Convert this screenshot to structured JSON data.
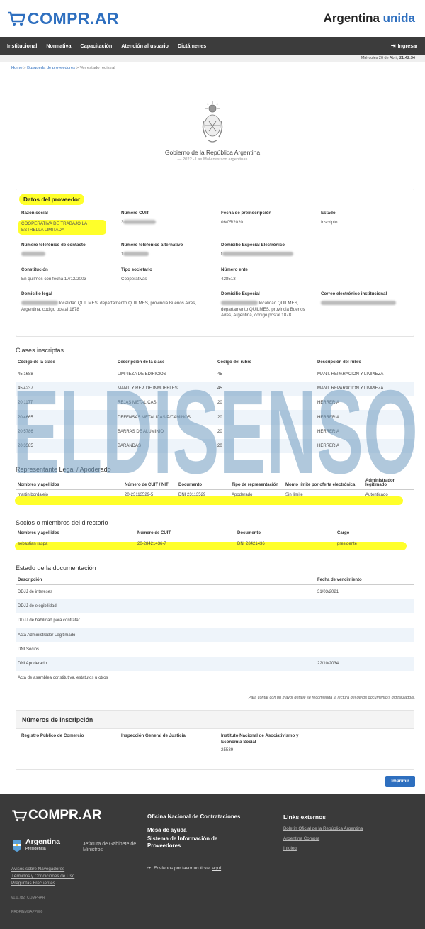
{
  "header": {
    "logo_text": "COMPR.AR",
    "brand_right_1": "Argentina",
    "brand_right_2": "unida"
  },
  "nav": {
    "items": [
      "Institucional",
      "Normativa",
      "Capacitación",
      "Atención al usuario",
      "Dictámenes"
    ],
    "login": "Ingresar"
  },
  "datebar": {
    "date": "Miércoles 20 de Abril,",
    "time": "21:42:34"
  },
  "breadcrumb": {
    "home": "Home",
    "search": "Busqueda de proveedores",
    "current": "Ver estado registral"
  },
  "gov": {
    "title": "Gobierno de la República Argentina",
    "subtitle": "— 2022 - Las Malvinas son argentinas"
  },
  "proveedor": {
    "title": "Datos del proveedor",
    "razon_label": "Razón social",
    "razon_value": "COOPERATIVA DE TRABAJO LA ESTRELLA LIMITADA",
    "cuit_label": "Número CUIT",
    "cuit_prefix": "3",
    "preins_label": "Fecha de preinscripción",
    "preins_value": "06/05/2020",
    "estado_label": "Estado",
    "estado_value": "Inscripto",
    "tel_label": "Número telefónico de contacto",
    "telalt_label": "Número telefónico alternativo",
    "telalt_prefix": "1",
    "domelec_label": "Domicilio Especial Electrónico",
    "domelec_prefix": "f",
    "const_label": "Constitución",
    "const_value": "En quilmes con fecha 17/12/2003",
    "tipo_label": "Tipo societario",
    "tipo_value": "Cooperativas",
    "ente_label": "Número ente",
    "ente_value": "428513",
    "domlegal_label": "Domicilio legal",
    "domlegal_value": "localidad QUILMES, departamento QUILMES, provincia Buenos Aires, Argentina, codigo postal 1878",
    "domesp_label": "Domicilio Especial",
    "domesp_value": "localidad QUILMES, departamento QUILMES, provincia Buenos Aires, Argentina, codigo postal 1878",
    "correo_label": "Correo electrónico institucional"
  },
  "clases": {
    "title": "Clases inscriptas",
    "headers": [
      "Código de la clase",
      "Descripción de la clase",
      "Código del rubro",
      "Descripción del rubro"
    ],
    "rows": [
      [
        "45.1688",
        "LIMPIEZA DE EDIFICIOS",
        "45",
        "MANT. REPARACION Y LIMPIEZA"
      ],
      [
        "45.4237",
        "MANT. Y REP. DE INMUEBLES",
        "45",
        "MANT. REPARACION Y LIMPIEZA"
      ],
      [
        "20.1177",
        "REJAS METALICAS",
        "20",
        "HERRERIA"
      ],
      [
        "20.4665",
        "DEFENSAS METALICAS P/CAMINOS",
        "20",
        "HERRERIA"
      ],
      [
        "20.5786",
        "BARRAS DE ALUMINIO",
        "20",
        "HERRERIA"
      ],
      [
        "20.3585",
        "BARANDAS",
        "20",
        "HERRERIA"
      ]
    ]
  },
  "watermark": {
    "text": "ELDISENSO"
  },
  "representante": {
    "title": "Representante Legal / Apoderado",
    "headers": [
      "Nombres y apellidos",
      "Número de CUIT / NIT",
      "Documento",
      "Tipo de representación",
      "Monto límite por oferta electrónica",
      "Administrador legitimado"
    ],
    "row": [
      "martin bordalejo",
      "20-23113529-5",
      "DNI 23113529",
      "Apoderado",
      "Sin límite",
      "Autenticado"
    ]
  },
  "socios": {
    "title": "Socios o miembros del directorio",
    "headers": [
      "Nombres y apellidos",
      "Número de CUIT",
      "Documento",
      "Cargo"
    ],
    "row": [
      "sebastian raspa",
      "20-28421436-7",
      "DNI 28421436",
      "presidente"
    ]
  },
  "documentacion": {
    "title": "Estado de la documentación",
    "headers": [
      "Descripción",
      "Fecha de vencimiento"
    ],
    "rows": [
      [
        "DDJJ de intereses",
        "31/03/2021"
      ],
      [
        "DDJJ de elegibilidad",
        ""
      ],
      [
        "DDJJ de habilidad para contratar",
        ""
      ],
      [
        "Acta Administrador Legitimado",
        ""
      ],
      [
        "DNI Socios",
        ""
      ],
      [
        "DNI Apoderado",
        "22/10/2034"
      ],
      [
        "Acta de asamblea constitutiva, estatutos u otros",
        ""
      ]
    ],
    "note": "Para contar con un mayor detalle se recomienda la lectura del de/los documento/s digitalizado/s."
  },
  "inscripcion": {
    "title": "Números de inscripción",
    "col1": "Registro Público de Comercio",
    "col2": "Inspección General de Justicia",
    "col3": "Instituto Nacional de Asociativismo y Economía Social",
    "col3_value": "25539"
  },
  "print_label": "Imprimir",
  "footer": {
    "logo_text": "COMPR.AR",
    "argentina": "Argentina",
    "presidencia": "Presidencia",
    "jgm": "Jefatura de Gabinete de Ministros",
    "mid_1": "Oficina Nacional de Contrataciones",
    "mid_2": "Mesa de ayuda",
    "mid_3": "Sistema de Información de Proveedores",
    "ticket_text": "Envíenos por favor un ticket",
    "ticket_link": "aquí",
    "links_title": "Links externos",
    "links": [
      "Boletín Oficial de la República Argentina",
      "Argentina Compra",
      "Infoleg"
    ],
    "left_links": [
      "Avisos sobre Navegadores",
      "Términos y Condiciones de Uso",
      "Preguntas Frecuentes"
    ],
    "version": "v1.0.782_COMPRAR",
    "code": "PRDFINMSAPP809"
  }
}
